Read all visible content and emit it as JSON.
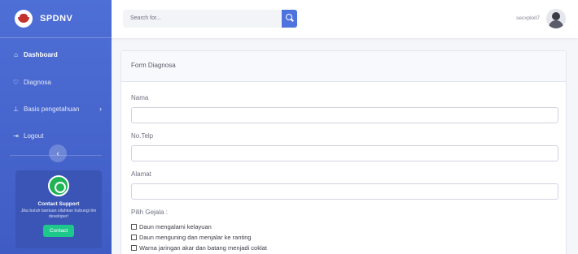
{
  "sidebar": {
    "brand": "SPDNV",
    "nav": [
      {
        "label": "Dashboard",
        "icon": "home-icon"
      },
      {
        "label": "Diagnosa",
        "icon": "stethoscope-icon"
      },
      {
        "label": "Basis pengetahuan",
        "icon": "pin-icon"
      },
      {
        "label": "Logout",
        "icon": "logout-icon"
      }
    ],
    "support": {
      "title": "Contact Support",
      "text": "Jika butuh bantuan silahkan hubungi tim developer!",
      "button": "Contact"
    }
  },
  "topbar": {
    "search_placeholder": "Search for...",
    "user": "secxploit7"
  },
  "form": {
    "title": "Form Diagnosa",
    "fields": {
      "nama": "Nama",
      "telp": "No.Telp",
      "alamat": "Alamat"
    },
    "gejala_label": "Pilih Gejala :",
    "gejala": [
      "Daun mengalami kelayuan",
      "Daun menguning dan menjalar ke ranting",
      "Warna jaringan akar dan batang menjadi coklat"
    ]
  },
  "colors": {
    "primary": "#4e73df",
    "success": "#1cc88a"
  }
}
